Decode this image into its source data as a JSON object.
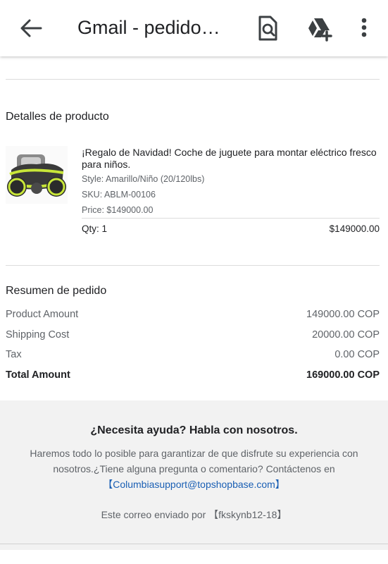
{
  "appbar": {
    "title": "Gmail - pedido…",
    "icons": [
      "back-arrow-icon",
      "find-in-page-icon",
      "google-drive-add-icon",
      "more-vert-icon"
    ]
  },
  "product_section": {
    "title": "Detalles de producto",
    "product": {
      "name": "¡Regalo de Navidad! Coche de juguete para montar eléctrico fresco para niños.",
      "style": "Style: Amarillo/Niño (20/120lbs)",
      "sku": "SKU: ABLM-00106",
      "price": "Price: $149000.00",
      "qty": "Qty: 1",
      "line_total": "$149000.00"
    }
  },
  "summary": {
    "title": "Resumen de pedido",
    "rows": [
      {
        "label": "Product Amount",
        "value": "149000.00 COP"
      },
      {
        "label": "Shipping Cost",
        "value": "20000.00 COP"
      },
      {
        "label": "Tax",
        "value": "0.00 COP"
      },
      {
        "label": "Total Amount",
        "value": "169000.00 COP"
      }
    ]
  },
  "help": {
    "title": "¿Necesita ayuda? Habla con nosotros.",
    "body": "Haremos todo lo posible para garantizar de que disfrute su experiencia con nosotros.¿Tiene alguna pregunta o comentario? Contáctenos en",
    "link": "【Columbiasupport@topshopbase.com】",
    "sent_by": "Este correo enviado por 【fkskynb12-18】"
  },
  "colors": {
    "accent_link": "#1a5fb4",
    "footer_bg": "#f2f2f2",
    "product_yellow": "#c8e639"
  }
}
